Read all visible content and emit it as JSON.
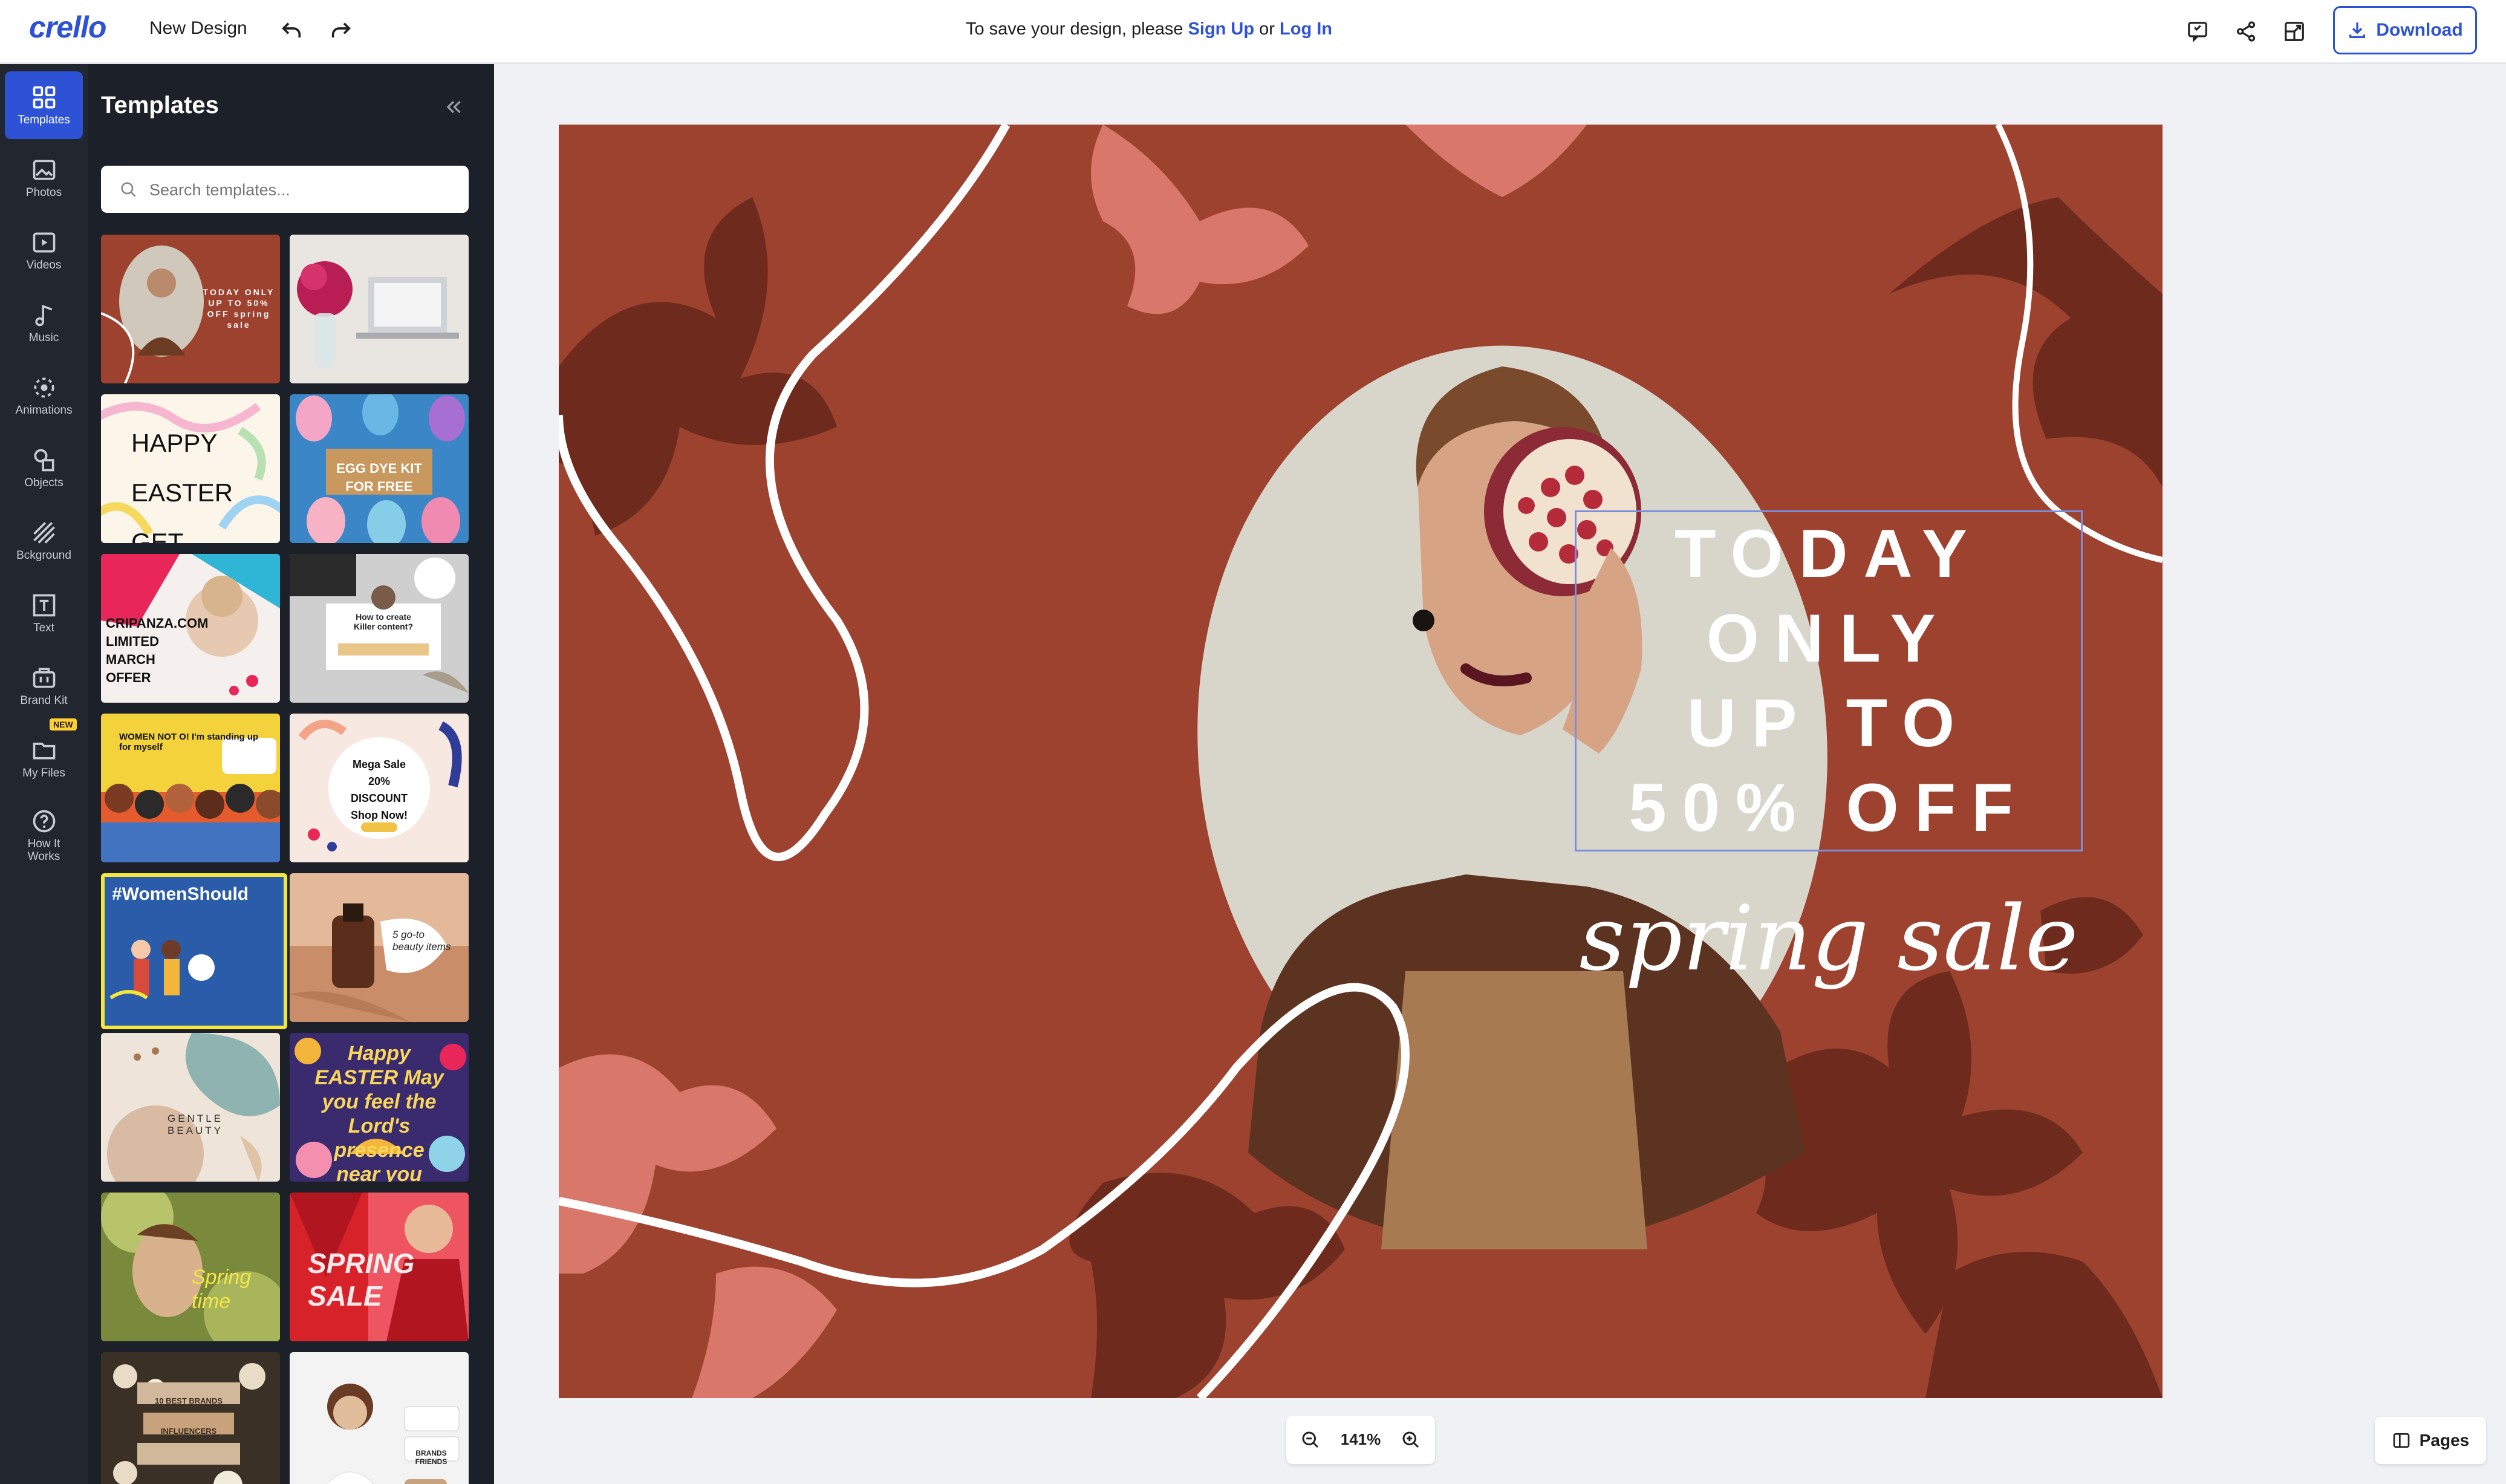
{
  "app": {
    "logo_text": "crello",
    "design_name": "New Design"
  },
  "topbar": {
    "save_message_prefix": "To save your design, please",
    "sign_up": "Sign Up",
    "or_text": "or",
    "log_in": "Log In",
    "download_label": "Download",
    "icons": [
      "undo-icon",
      "redo-icon",
      "feedback-icon",
      "share-icon",
      "resize-icon",
      "download-icon"
    ]
  },
  "rail": {
    "items": [
      {
        "label": "Templates",
        "icon": "templates-icon",
        "active": true
      },
      {
        "label": "Photos",
        "icon": "photo-icon"
      },
      {
        "label": "Videos",
        "icon": "video-icon"
      },
      {
        "label": "Music",
        "icon": "music-icon"
      },
      {
        "label": "Animations",
        "icon": "animation-icon"
      },
      {
        "label": "Objects",
        "icon": "objects-icon"
      },
      {
        "label": "Bckground",
        "icon": "background-icon"
      },
      {
        "label": "Text",
        "icon": "text-icon"
      },
      {
        "label": "Brand Kit",
        "icon": "brand-kit-icon",
        "badge": "NEW"
      },
      {
        "label": "My Files",
        "icon": "folder-icon"
      },
      {
        "label": "How It Works",
        "icon": "help-icon"
      }
    ]
  },
  "panel": {
    "title": "Templates",
    "search_placeholder": "Search templates...",
    "thumbnails": [
      {
        "text": "TODAY ONLY UP TO 50% OFF spring sale",
        "bg": "#9e4230"
      },
      {
        "text": "",
        "bg": "#e9e5e1"
      },
      {
        "text": "HAPPY EASTER GET YOUR GIFT!",
        "bg": "#fbf5ea"
      },
      {
        "text": "EGG DYE KIT FOR FREE",
        "bg": "#3a86c7"
      },
      {
        "text": "CRIPANZA.COM LIMITED MARCH OFFER",
        "bg": "#f5f0ee"
      },
      {
        "text": "How to create Killer content?",
        "bg": "#cfcfcf"
      },
      {
        "text": "WOMEN NOT O! I'm standing up for myself",
        "bg": "#f4d23c"
      },
      {
        "text": "Mega Sale 20% DISCOUNT Shop Now!",
        "bg": "#f7e9e2"
      },
      {
        "text": "#WomenShould",
        "bg": "#2a5caa"
      },
      {
        "text": "5 go-to beauty items",
        "bg": "#c98e69"
      },
      {
        "text": "GENTLE BEAUTY",
        "bg": "#efe4da"
      },
      {
        "text": "Happy EASTER May you feel the Lord's presence near you",
        "bg": "#3a2a6e"
      },
      {
        "text": "Spring time",
        "bg": "#7a8a3c"
      },
      {
        "text": "SPRING SALE",
        "bg": "#d8222a"
      },
      {
        "text": "10 BEST BRANDS INFLUENCERS",
        "bg": "#3a3026"
      },
      {
        "text": "BRANDS FRIENDS",
        "bg": "#f3f3f3"
      }
    ]
  },
  "canvas": {
    "headline_lines": [
      "TODAY",
      "ONLY",
      "UP TO",
      "50% OFF"
    ],
    "script_text": "spring sale",
    "bg_color": "#9e4230"
  },
  "zoom": {
    "value": "141%"
  },
  "pages": {
    "label": "Pages"
  }
}
